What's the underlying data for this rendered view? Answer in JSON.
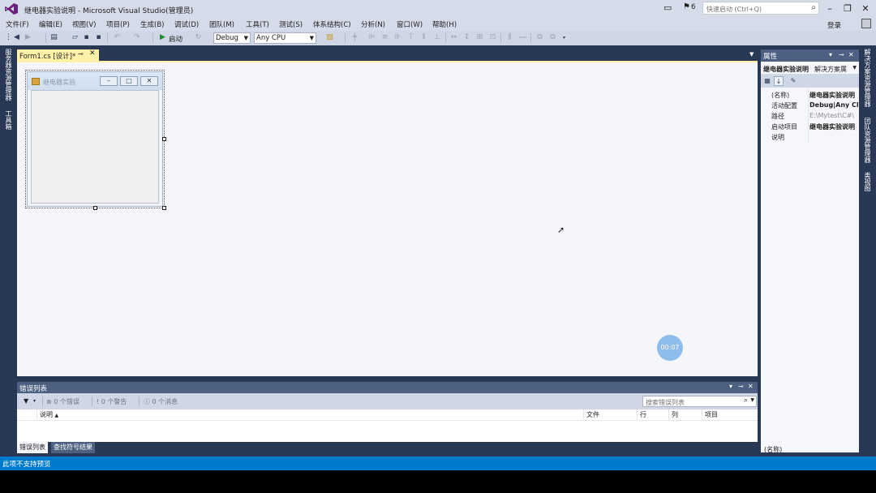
{
  "window": {
    "title": "继电器实验说明 - Microsoft Visual Studio(管理员)",
    "notification_count": "6",
    "quick_launch_placeholder": "快速启动 (Ctrl+Q)"
  },
  "menu": {
    "items": [
      "文件(F)",
      "编辑(E)",
      "视图(V)",
      "项目(P)",
      "生成(B)",
      "调试(D)",
      "团队(M)",
      "工具(T)",
      "测试(S)",
      "体系结构(C)",
      "分析(N)",
      "窗口(W)",
      "帮助(H)"
    ],
    "login": "登录"
  },
  "toolbar": {
    "start_label": "启动",
    "config": "Debug",
    "platform": "Any CPU"
  },
  "left_rail": {
    "server_explorer": "服务器资源管理器",
    "toolbox": "工具箱"
  },
  "document": {
    "tab_label": "Form1.cs [设计]*",
    "form_title": "继电器实验"
  },
  "overlay": {
    "timer": "00:07"
  },
  "error_list": {
    "title": "错误列表",
    "errors": "0 个错误",
    "warnings": "0 个警告",
    "messages": "0 个消息",
    "search_placeholder": "搜索错误列表",
    "columns": {
      "description": "说明",
      "file": "文件",
      "line": "行",
      "column": "列",
      "project": "项目"
    },
    "tabs": [
      "错误列表",
      "查找符号结果"
    ]
  },
  "properties": {
    "title": "属性",
    "object_name": "继电器实验说明",
    "object_type": "解决方案属",
    "rows": [
      {
        "name": "(名称)",
        "value": "继电器实验说明",
        "style": "bold"
      },
      {
        "name": "活动配置",
        "value": "Debug|Any CPU",
        "style": "bold"
      },
      {
        "name": "路径",
        "value": "E:\\Mytest\\C#\\",
        "style": "dim"
      },
      {
        "name": "启动项目",
        "value": "继电器实验说明",
        "style": "bold"
      },
      {
        "name": "说明",
        "value": "",
        "style": ""
      }
    ],
    "description_title": "(名称)"
  },
  "right_rail": {
    "solution_explorer": "解决方案资源管理器",
    "team_explorer": "团队资源管理器",
    "class_view": "类视图"
  },
  "status": {
    "text": "此项不支持预览"
  },
  "colors": {
    "chrome_bg": "#d6dbe9",
    "workspace_bg": "#293955",
    "active_tab": "#fff1a8",
    "panel_header": "#4d6082",
    "status_bar": "#007acc"
  }
}
